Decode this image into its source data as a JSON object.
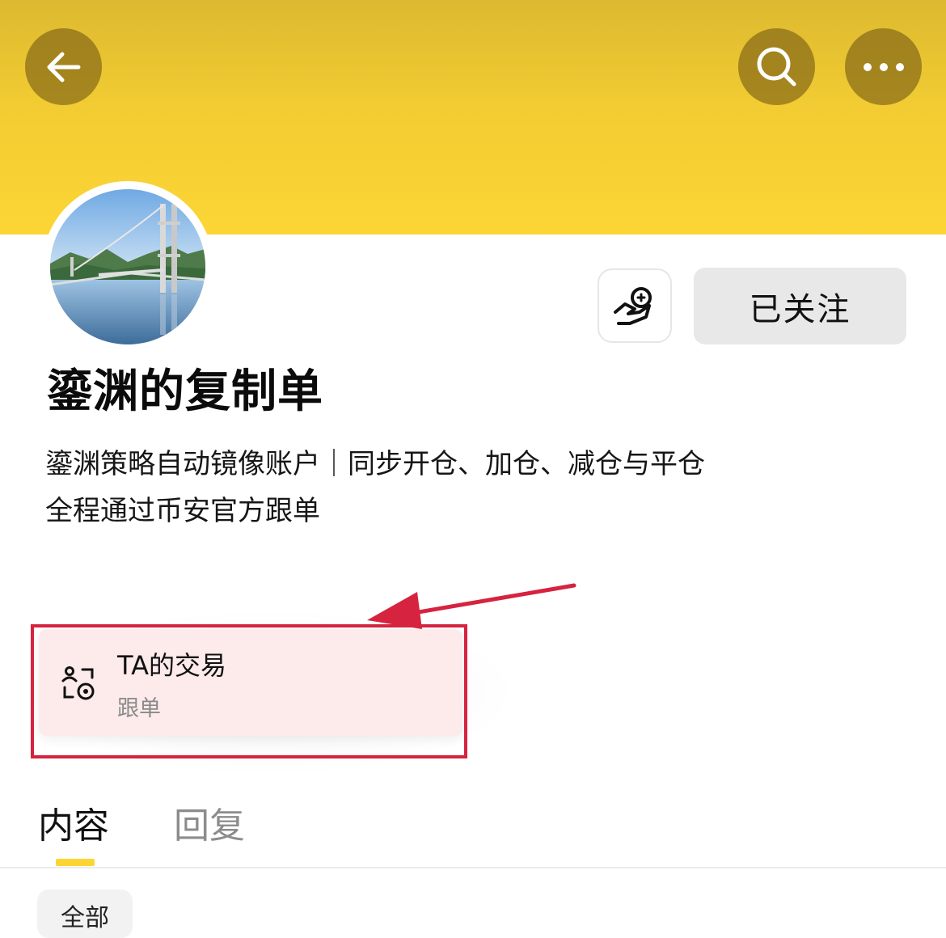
{
  "header": {
    "back_icon": "arrow-left-icon",
    "search_icon": "search-icon",
    "more_icon": "ellipsis-icon",
    "banner_color": "#fcd535"
  },
  "profile": {
    "avatar": "bridge-landscape-photo",
    "name": "鎏渊的复制单",
    "bio_line1": "鎏渊策略自动镜像账户｜同步开仓、加仓、减仓与平仓",
    "bio_line2": "全程通过币安官方跟单",
    "tip_icon": "tip-hand-icon",
    "follow_label": "已关注"
  },
  "trade_card": {
    "icon": "copy-trade-icon",
    "title": "TA的交易",
    "subtitle": "跟单",
    "highlight_color": "#d6233f"
  },
  "tabs": [
    {
      "label": "内容",
      "active": true
    },
    {
      "label": "回复",
      "active": false
    }
  ],
  "filter": {
    "chip_label": "全部"
  }
}
